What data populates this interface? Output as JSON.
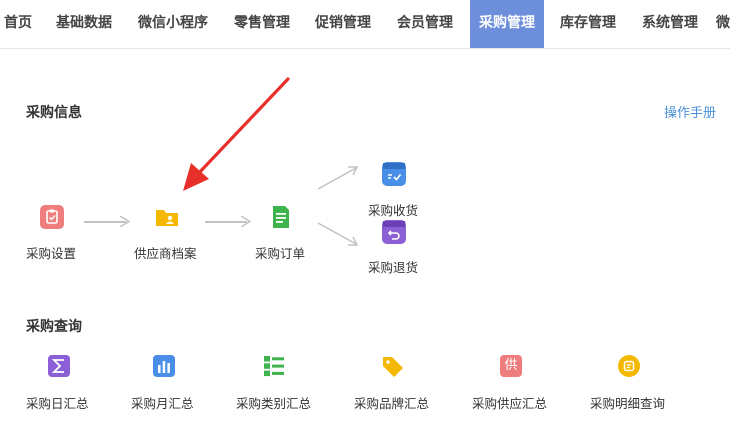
{
  "nav": {
    "items": [
      "首页",
      "基础数据",
      "微信小程序",
      "零售管理",
      "促销管理",
      "会员管理",
      "采购管理",
      "库存管理",
      "系统管理",
      "微"
    ],
    "active_index": 6,
    "active_color": "#6d8edb"
  },
  "purchase_info": {
    "title": "采购信息",
    "manual_link": "操作手册",
    "flow": [
      {
        "label": "采购设置",
        "icon": "settings-icon",
        "color": "#f07d7d"
      },
      {
        "label": "供应商档案",
        "icon": "folder-user-icon",
        "color": "#f5b800"
      },
      {
        "label": "采购订单",
        "icon": "document-icon",
        "color": "#3eb34e"
      },
      {
        "label": "采购收货",
        "icon": "box-check-icon",
        "color": "#4a8fe7"
      },
      {
        "label": "采购退货",
        "icon": "box-return-icon",
        "color": "#8b5fd6"
      }
    ]
  },
  "purchase_query": {
    "title": "采购查询",
    "items": [
      {
        "label": "采购日汇总",
        "icon": "sigma-icon",
        "color": "#8b5fd6"
      },
      {
        "label": "采购月汇总",
        "icon": "bar-chart-icon",
        "color": "#4a8fe7"
      },
      {
        "label": "采购类别汇总",
        "icon": "list-icon",
        "color": "#3eb34e"
      },
      {
        "label": "采购品牌汇总",
        "icon": "tag-icon",
        "color": "#f5b800"
      },
      {
        "label": "采购供应汇总",
        "icon": "supplier-icon",
        "color": "#f07d7d",
        "glyph": "供"
      },
      {
        "label": "采购明细查询",
        "icon": "detail-icon",
        "color": "#f5b800"
      }
    ]
  },
  "annotation_color": "#e8302b"
}
